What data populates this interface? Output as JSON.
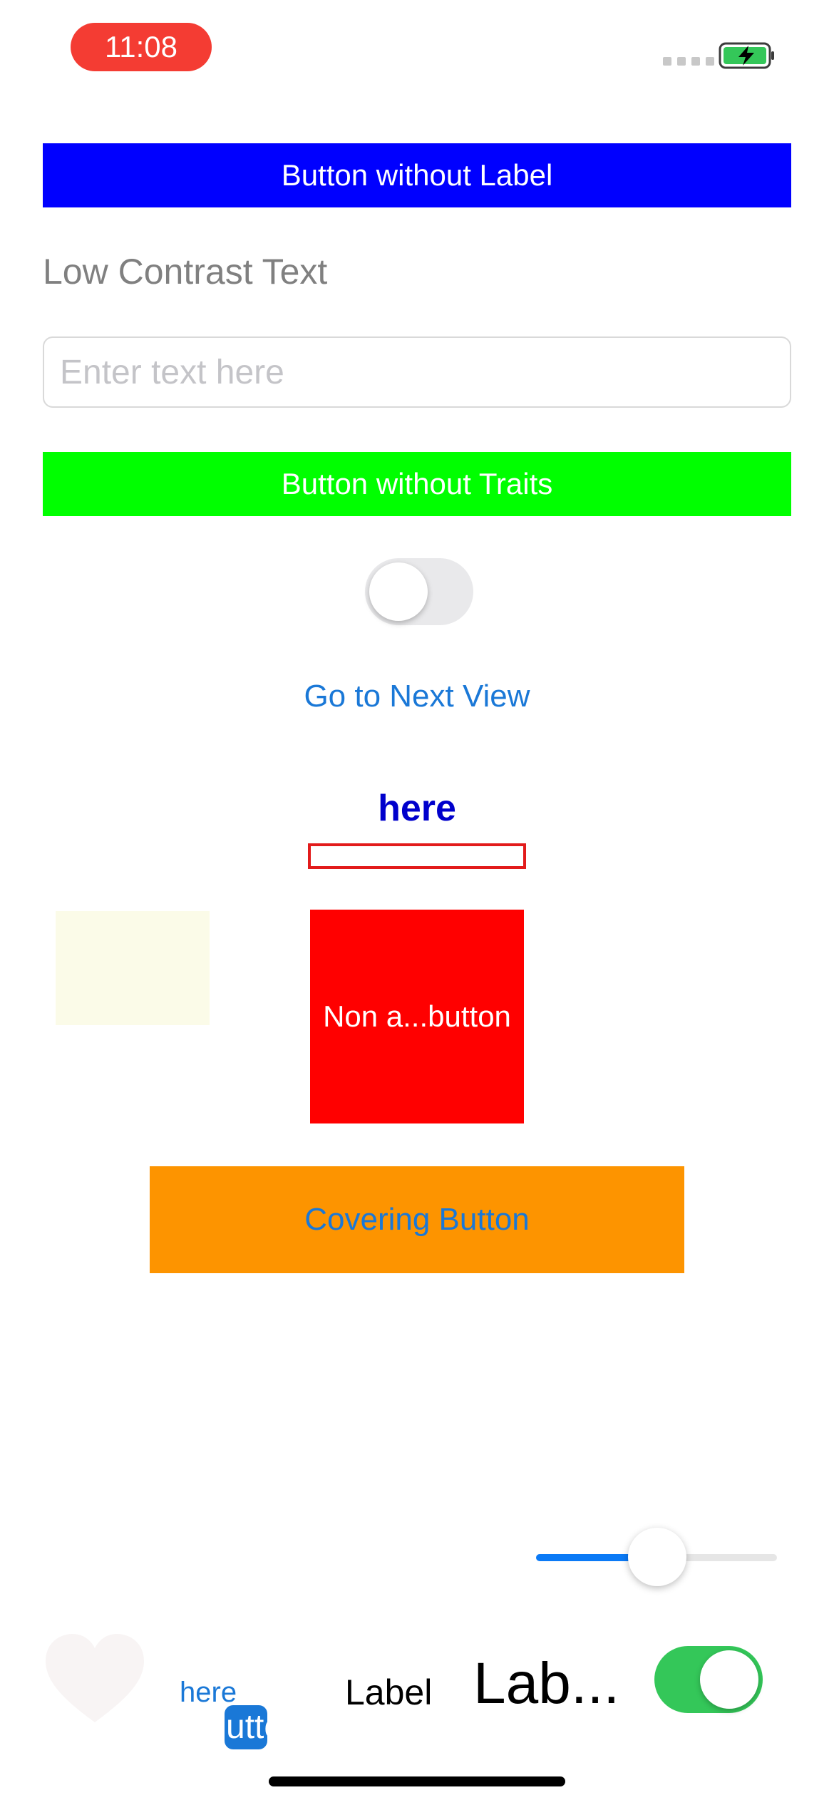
{
  "status_bar": {
    "time": "11:08",
    "battery_icon": "battery-charging-icon",
    "signal_icon": "signal-icon"
  },
  "buttons": {
    "no_label": "Button without Label",
    "no_traits": "Button without Traits",
    "next_view": "Go to Next View",
    "non_accessible": "Non a...button",
    "covering": "Covering Button",
    "small_button_text": "Button"
  },
  "labels": {
    "low_contrast": "Low Contrast Text",
    "here_top": "here",
    "here_bottom": "here",
    "label_small": "Label",
    "label_truncated": "Lab..."
  },
  "text_field": {
    "placeholder": "Enter text here",
    "value": ""
  },
  "switches": {
    "middle": "off",
    "bottom": "on"
  },
  "slider": {
    "value": 0.5
  },
  "colors": {
    "blue_button": "#0000ff",
    "green_button": "#00ff00",
    "red_square": "#ff0000",
    "orange_button": "#fd9400",
    "link_blue": "#1a78d7",
    "switch_on": "#34c759",
    "time_pill": "#f43c33"
  },
  "icons": {
    "heart": "heart-icon"
  }
}
